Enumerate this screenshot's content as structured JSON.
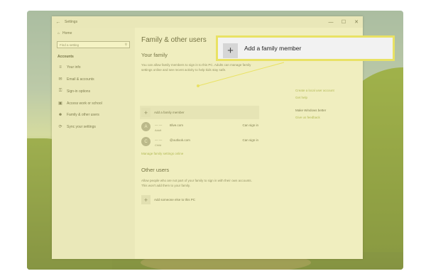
{
  "window": {
    "title": "Settings",
    "back_glyph": "←",
    "controls": {
      "minimize": "—",
      "maximize": "☐",
      "close": "✕"
    }
  },
  "sidebar": {
    "home": "Home",
    "search_placeholder": "Find a setting",
    "section_heading": "Accounts",
    "items": [
      {
        "label": "Your info",
        "icon": "person-card-icon"
      },
      {
        "label": "Email & accounts",
        "icon": "mail-icon"
      },
      {
        "label": "Sign-in options",
        "icon": "key-icon"
      },
      {
        "label": "Access work or school",
        "icon": "briefcase-icon"
      },
      {
        "label": "Family & other users",
        "icon": "people-icon"
      },
      {
        "label": "Sync your settings",
        "icon": "sync-icon"
      }
    ]
  },
  "main": {
    "title": "Family & other users",
    "your_family_heading": "Your family",
    "your_family_desc": "You can allow family members to sign in to this PC. Adults can manage family settings online and see recent activity to help kids stay safe.",
    "add_family_label": "Add a family member",
    "members": [
      {
        "initial": "A",
        "masked": "— —",
        "email": "8live.com",
        "role": "Adult",
        "action": "Can sign in"
      },
      {
        "initial": "C",
        "masked": "— —",
        "email": "@outlook.com",
        "role": "Child",
        "action": "Can sign in"
      }
    ],
    "manage_link": "Manage family settings online",
    "other_users_heading": "Other users",
    "other_users_desc": "Allow people who are not part of your family to sign in with their own accounts. This won't add them to your family.",
    "add_other_label": "Add someone else to this PC",
    "right_links": {
      "local_account": "Create a local user account",
      "get_help": "Get help",
      "make_better_heading": "Make Windows better",
      "feedback": "Give us feedback"
    }
  },
  "callout": {
    "label": "Add a family member",
    "highlight_color": "#e9e264"
  }
}
